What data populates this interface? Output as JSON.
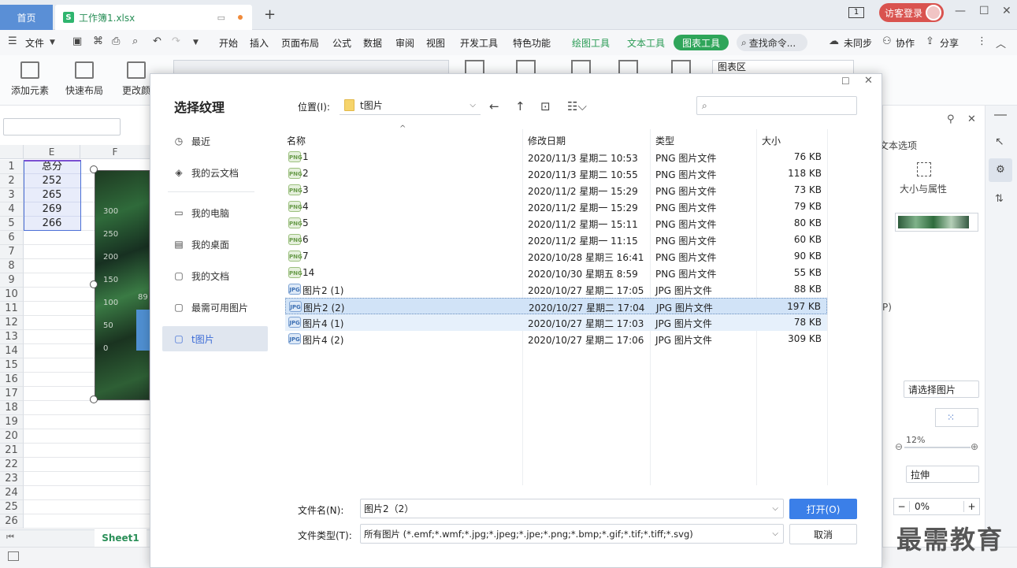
{
  "tabs": {
    "home": "首页",
    "file": "工作簿1.xlsx",
    "new_tab": "+"
  },
  "header_right": {
    "badge": "1",
    "visitor_login": "访客登录"
  },
  "menu": {
    "file": "文件",
    "items": [
      "开始",
      "插入",
      "页面布局",
      "公式",
      "数据",
      "审阅",
      "视图",
      "开发工具",
      "特色功能"
    ],
    "context_tabs": [
      "绘图工具",
      "文本工具"
    ],
    "chart_tools": "图表工具",
    "search_cmd": "查找命令...",
    "right": [
      "未同步",
      "协作",
      "分享"
    ]
  },
  "ribbon": {
    "add_element": "添加元素",
    "quick_layout": "快速布局",
    "change": "更改颜",
    "chart_area": "图表区"
  },
  "sheet": {
    "col_e": "E",
    "col_f": "F",
    "rows": [
      "1",
      "2",
      "3",
      "4",
      "5",
      "6",
      "7",
      "8",
      "9",
      "10",
      "11",
      "12",
      "13",
      "14",
      "15",
      "16",
      "17",
      "18",
      "19",
      "20",
      "21",
      "22",
      "23",
      "24",
      "25",
      "26"
    ],
    "cells_e": [
      "总分",
      "252",
      "265",
      "269",
      "266"
    ],
    "axis_labels": [
      "300",
      "250",
      "200",
      "150",
      "100",
      "50",
      "0"
    ],
    "data_label": "89",
    "sheet_tab": "Sheet1"
  },
  "right_panel": {
    "text_options": "文本选项",
    "size_props": "大小与属性",
    "select_picture": "请选择图片",
    "scale": "12%",
    "stretch": "拉伸",
    "offset": "0%"
  },
  "dialog": {
    "title": "选择纹理",
    "sidebar": [
      "最近",
      "我的云文档",
      "我的电脑",
      "我的桌面",
      "我的文档",
      "最需可用图片",
      "t图片"
    ],
    "location_label": "位置(I):",
    "location_value": "t图片",
    "columns": {
      "name": "名称",
      "date": "修改日期",
      "type": "类型",
      "size": "大小"
    },
    "files": [
      {
        "name": "1",
        "date": "2020/11/3 星期二 10:53",
        "type": "PNG 图片文件",
        "size": "76 KB",
        "kind": "png"
      },
      {
        "name": "2",
        "date": "2020/11/3 星期二 10:55",
        "type": "PNG 图片文件",
        "size": "118 KB",
        "kind": "png"
      },
      {
        "name": "3",
        "date": "2020/11/2 星期一 15:29",
        "type": "PNG 图片文件",
        "size": "73 KB",
        "kind": "png"
      },
      {
        "name": "4",
        "date": "2020/11/2 星期一 15:29",
        "type": "PNG 图片文件",
        "size": "79 KB",
        "kind": "png"
      },
      {
        "name": "5",
        "date": "2020/11/2 星期一 15:11",
        "type": "PNG 图片文件",
        "size": "80 KB",
        "kind": "png"
      },
      {
        "name": "6",
        "date": "2020/11/2 星期一 11:15",
        "type": "PNG 图片文件",
        "size": "60 KB",
        "kind": "png"
      },
      {
        "name": "7",
        "date": "2020/10/28 星期三 16:41",
        "type": "PNG 图片文件",
        "size": "90 KB",
        "kind": "png"
      },
      {
        "name": "14",
        "date": "2020/10/30 星期五 8:59",
        "type": "PNG 图片文件",
        "size": "55 KB",
        "kind": "png"
      },
      {
        "name": "图片2 (1)",
        "date": "2020/10/27 星期二 17:05",
        "type": "JPG 图片文件",
        "size": "88 KB",
        "kind": "jpg"
      },
      {
        "name": "图片2 (2)",
        "date": "2020/10/27 星期二 17:04",
        "type": "JPG 图片文件",
        "size": "197 KB",
        "kind": "jpg"
      },
      {
        "name": "图片4 (1)",
        "date": "2020/10/27 星期二 17:03",
        "type": "JPG 图片文件",
        "size": "78 KB",
        "kind": "jpg"
      },
      {
        "name": "图片4 (2)",
        "date": "2020/10/27 星期二 17:06",
        "type": "JPG 图片文件",
        "size": "309 KB",
        "kind": "jpg"
      }
    ],
    "selected_file": "图片2 (2)",
    "filename_label": "文件名(N):",
    "filename_value": "图片2（2）",
    "filetype_label": "文件类型(T):",
    "filetype_value": "所有图片 (*.emf;*.wmf;*.jpg;*.jpeg;*.jpe;*.png;*.bmp;*.gif;*.tif;*.tiff;*.svg)",
    "open_button": "打开(O)",
    "cancel_button": "取消"
  },
  "watermark": "最需教育"
}
